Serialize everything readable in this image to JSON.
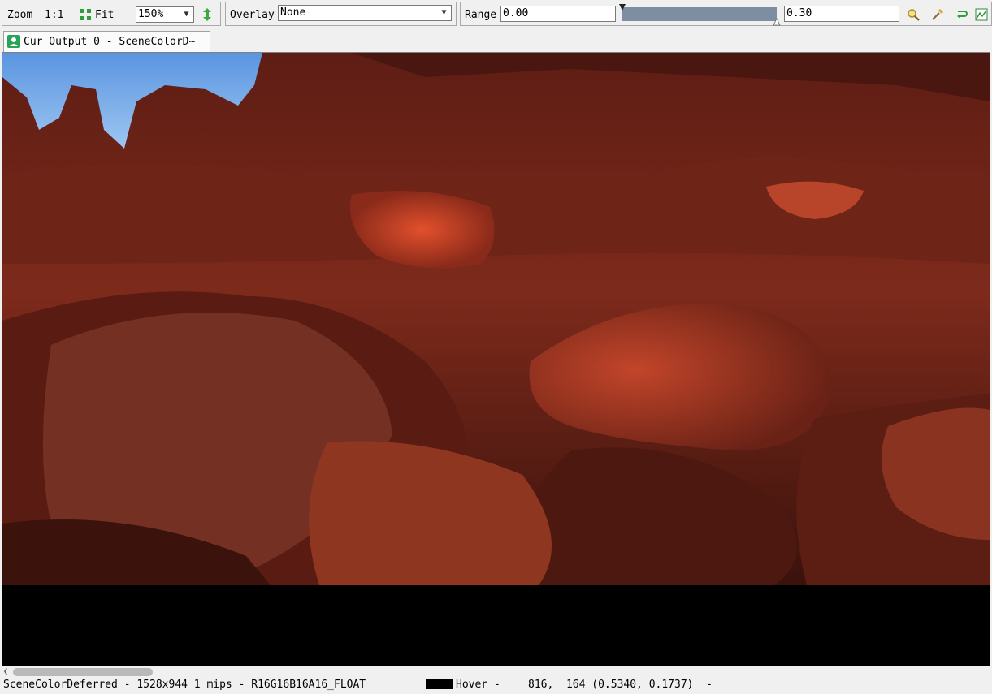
{
  "toolbar": {
    "zoom_label": "Zoom",
    "zoom_1to1_label": "1:1",
    "fit_label": "Fit",
    "zoom_value": "150%",
    "overlay_label": "Overlay",
    "overlay_value": "None",
    "range_label": "Range",
    "range_min": "0.00",
    "range_max": "0.30",
    "range_slider_fraction_start": 0.0,
    "range_slider_fraction_end": 1.0,
    "icons": [
      "fit-icon",
      "flip-icon",
      "zoom-range-icon",
      "pick-icon",
      "reset-range-icon",
      "histogram-icon"
    ]
  },
  "tab": {
    "label": "Cur Output 0 - SceneColorD⋯"
  },
  "status": {
    "texture_info": "SceneColorDeferred - 1528x944 1 mips - R16G16B16A16_FLOAT",
    "hover_label": "Hover -",
    "hover_coords": "816,  164 (0.5340, 0.1737)  -"
  },
  "colors": {
    "accent_green": "#27a35a",
    "range_bar": "#7d8ea3",
    "rock_red": "#8a2a1a",
    "sky_blue": "#6fa6e8"
  }
}
